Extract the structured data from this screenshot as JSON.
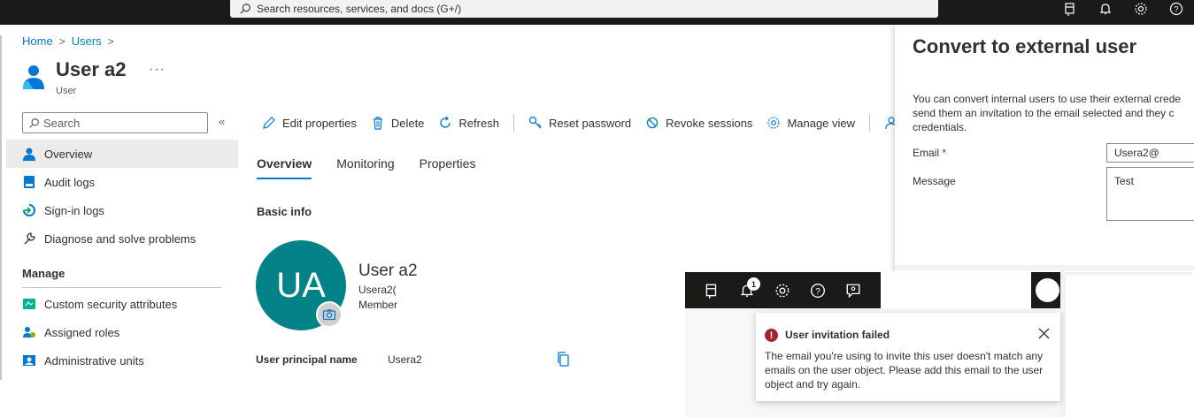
{
  "topbar": {
    "search_placeholder": "Search resources, services, and docs (G+/)",
    "icons": [
      "feedback-icon",
      "bell-icon",
      "gear-icon",
      "help-icon"
    ]
  },
  "breadcrumb": {
    "home": "Home",
    "users": "Users",
    "sep": ">"
  },
  "header": {
    "title": "User a2",
    "more": "···",
    "subtitle": "User"
  },
  "sidebar": {
    "search_placeholder": "Search",
    "collapse": "«",
    "items": [
      {
        "label": "Overview",
        "icon": "user-icon",
        "active": true
      },
      {
        "label": "Audit logs",
        "icon": "audit-logs-icon"
      },
      {
        "label": "Sign-in logs",
        "icon": "sign-in-icon"
      },
      {
        "label": "Diagnose and solve problems",
        "icon": "wrench-icon"
      }
    ],
    "section": "Manage",
    "manage_items": [
      {
        "label": "Custom security attributes",
        "icon": "security-attributes-icon"
      },
      {
        "label": "Assigned roles",
        "icon": "assigned-roles-icon"
      },
      {
        "label": "Administrative units",
        "icon": "admin-units-icon"
      }
    ]
  },
  "toolbar": {
    "edit": "Edit properties",
    "delete": "Delete",
    "refresh": "Refresh",
    "reset_password": "Reset password",
    "revoke": "Revoke sessions",
    "manage_view": "Manage view"
  },
  "tabs": [
    "Overview",
    "Monitoring",
    "Properties"
  ],
  "basic_info": "Basic info",
  "profile": {
    "initials": "UA",
    "name": "User a2",
    "upn_short": "Usera2(",
    "type": "Member"
  },
  "upn": {
    "label": "User principal name",
    "value": "Usera2"
  },
  "panel": {
    "title": "Convert to external user",
    "desc_line1": "You can convert internal users to use their external crede",
    "desc_line2": "send them an invitation to the email selected and they c",
    "desc_line3": "credentials.",
    "email_label": "Email",
    "required_mark": "*",
    "email_value": "Usera2@",
    "message_label": "Message",
    "message_value": "Test"
  },
  "popup": {
    "badge_count": "1"
  },
  "toast": {
    "title": "User invitation failed",
    "body": "The email you're using to invite this user doesn't match any emails on the user object. Please add this email to the user object and try again."
  },
  "colors": {
    "accent": "#0078d4",
    "avatar_bg": "#038387",
    "error": "#a4262c",
    "topbar": "#1b1a19"
  }
}
